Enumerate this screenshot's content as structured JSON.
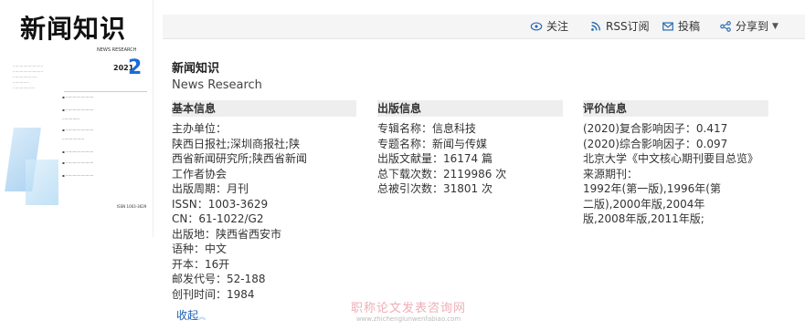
{
  "cover": {
    "title": "新闻知识",
    "subtitle": "NEWS RESEARCH",
    "year": "2021",
    "issue": "2",
    "issn": "ISSN 1003-3629"
  },
  "topbar": {
    "follow": "关注",
    "rss": "RSS订阅",
    "submit": "投稿",
    "share": "分享到"
  },
  "journal": {
    "name_cn": "新闻知识",
    "name_en": "News Research"
  },
  "basic": {
    "header": "基本信息",
    "lines": [
      "主办单位：",
      "陕西日报社;深圳商报社;陕",
      "西省新闻研究所;陕西省新闻",
      "工作者协会",
      "出版周期：月刊",
      "ISSN：1003-3629",
      "CN：61-1022/G2",
      "出版地：陕西省西安市",
      "语种：中文",
      "开本：16开",
      "邮发代号：52-188",
      "创刊时间：1984"
    ],
    "collapse": "收起"
  },
  "publish": {
    "header": "出版信息",
    "lines": [
      "专辑名称：信息科技",
      "专题名称：新闻与传媒",
      "出版文献量：16174 篇",
      "总下载次数：2119986 次",
      "总被引次数：31801 次"
    ]
  },
  "evaluation": {
    "header": "评价信息",
    "lines": [
      "(2020)复合影响因子：0.417",
      "(2020)综合影响因子：0.097",
      "北京大学《中文核心期刊要目总览》",
      "来源期刊：",
      "1992年(第一版),1996年(第",
      "二版),2000年版,2004年",
      "版,2008年版,2011年版;"
    ]
  },
  "watermark": {
    "cn": "职称论文发表咨询网",
    "en": "www.zhichenglunwenfabiao.com"
  },
  "colors": {
    "accent": "#1a5fb4",
    "icon": "#2b6cb0",
    "header_bg": "#eeeeee"
  }
}
